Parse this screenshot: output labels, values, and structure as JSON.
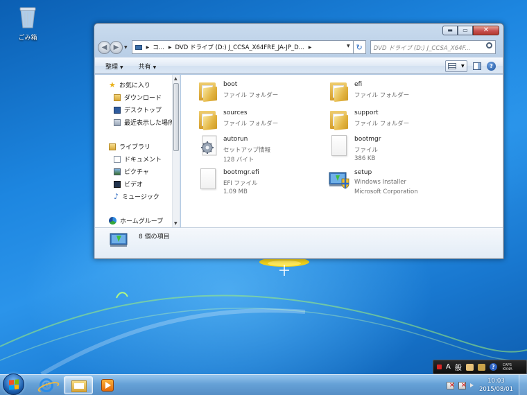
{
  "desktop": {
    "recycle_bin_label": "ごみ箱"
  },
  "window": {
    "minimize_icon": "minimize-icon",
    "maximize_icon": "maximize-icon",
    "close_icon": "close-icon",
    "address": {
      "crumbs": [
        "コ...",
        "DVD ドライブ (D:) J_CCSA_X64FRE_JA-JP_D..."
      ]
    },
    "search": {
      "placeholder": "DVD ドライブ (D:) J_CCSA_X64F..."
    },
    "commands": {
      "organize": "整理",
      "share": "共有"
    },
    "nav_pane": {
      "favorites": "お気に入り",
      "downloads": "ダウンロード",
      "desktop": "デスクトップ",
      "recent": "最近表示した場所",
      "libraries": "ライブラリ",
      "documents": "ドキュメント",
      "pictures": "ピクチャ",
      "videos": "ビデオ",
      "music": "ミュージック",
      "homegroup": "ホームグループ"
    },
    "files": [
      {
        "name": "boot",
        "type": "ファイル フォルダー",
        "extra": ""
      },
      {
        "name": "efi",
        "type": "ファイル フォルダー",
        "extra": ""
      },
      {
        "name": "sources",
        "type": "ファイル フォルダー",
        "extra": ""
      },
      {
        "name": "support",
        "type": "ファイル フォルダー",
        "extra": ""
      },
      {
        "name": "autorun",
        "type": "セットアップ情報",
        "extra": "128 バイト"
      },
      {
        "name": "bootmgr",
        "type": "ファイル",
        "extra": "386 KB"
      },
      {
        "name": "bootmgr.efi",
        "type": "EFI ファイル",
        "extra": "1.09 MB"
      },
      {
        "name": "setup",
        "type": "Windows Installer",
        "extra": "Microsoft Corporation"
      }
    ],
    "details": {
      "item_count": "8 個の項目"
    }
  },
  "taskbar": {
    "clock_time": "10:03",
    "clock_date": "2015/08/01"
  },
  "langbar": {
    "mode_a": "A",
    "mode_kanji": "般",
    "caps_label": "CAPS",
    "kana_label": "KANA",
    "help": "?"
  },
  "colors": {
    "accent": "#1e7fd6",
    "window_frame": "#b5cbe4"
  }
}
